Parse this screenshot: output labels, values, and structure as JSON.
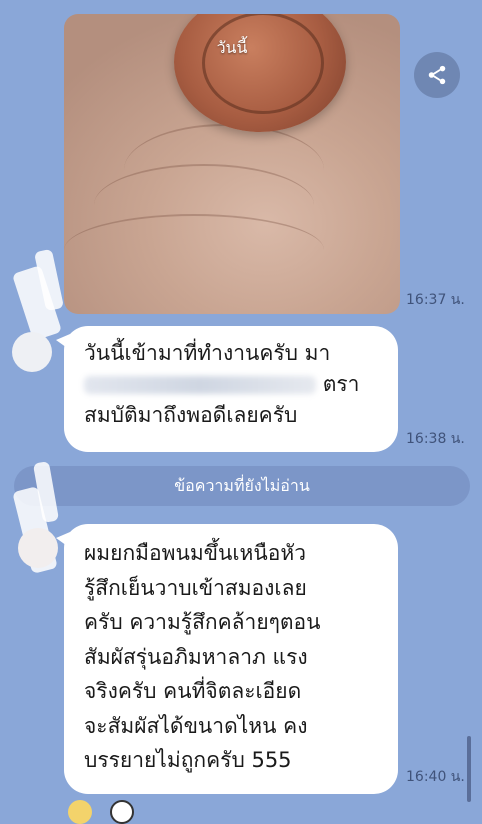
{
  "messages": {
    "image": {
      "caption": "วันนี้",
      "time": "16:37 น."
    },
    "text1": {
      "line1": "วันนี้เข้ามาที่ทำงานครับ มา",
      "line2_visible": "ตรา",
      "line3": "สมบัติมาถึงพอดีเลยครับ",
      "time": "16:38 น."
    },
    "unread_divider": "ข้อความที่ยังไม่อ่าน",
    "text2": {
      "lines": [
        "ผมยกมือพนมขึ้นเหนือหัว",
        "รู้สึกเย็นวาบเข้าสมองเลย",
        "ครับ ความรู้สึกคล้ายๆตอน",
        "สัมผัสรุ่นอภิมหาลาภ แรง",
        "จริงครับ คนที่จิตละเอียด",
        "จะสัมผัสได้ขนาดไหน คง",
        "บรรยายไม่ถูกครับ 555"
      ],
      "time": "16:40 น."
    }
  },
  "icons": {
    "share": "share-icon"
  },
  "colors": {
    "background": "#8aa7d8",
    "bubble": "#ffffff",
    "divider": "#7c96c8"
  }
}
